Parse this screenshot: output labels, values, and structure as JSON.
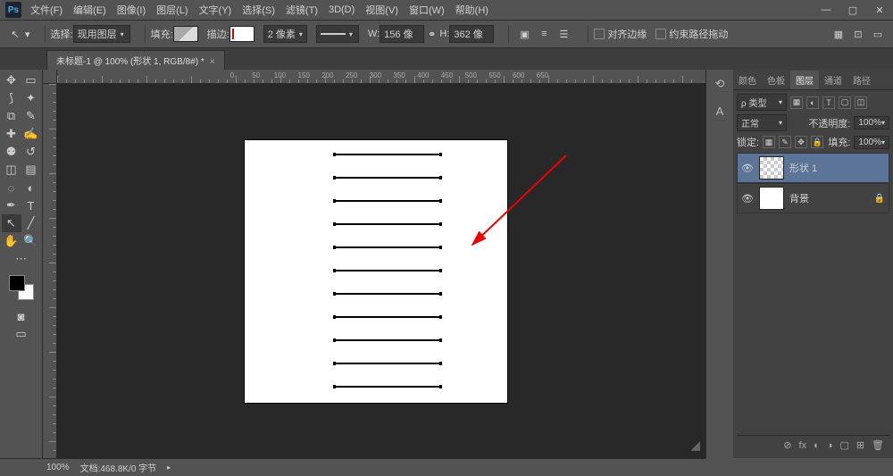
{
  "menu": {
    "items": [
      "文件(F)",
      "编辑(E)",
      "图像(I)",
      "图层(L)",
      "文字(Y)",
      "选择(S)",
      "滤镜(T)",
      "3D(D)",
      "视图(V)",
      "窗口(W)",
      "帮助(H)"
    ]
  },
  "logo": "Ps",
  "opt": {
    "select_label": "选择:",
    "select_value": "现用图层",
    "fill_label": "填充:",
    "stroke_label": "描边:",
    "stroke_width": "2 像素",
    "w_label": "W:",
    "w_value": "156 像",
    "link": "⚭",
    "h_label": "H:",
    "h_value": "362 像",
    "align_edges": "对齐边缘",
    "constrain": "约束路径拖动"
  },
  "tab": {
    "title": "未标题-1 @ 100% (形状 1, RGB/8#) *"
  },
  "ruler_labels": [
    "0",
    "50",
    "100",
    "150",
    "200",
    "250",
    "300",
    "350",
    "400",
    "450",
    "500",
    "550",
    "600",
    "650"
  ],
  "ruler_v": [
    "0",
    "5",
    "0",
    "0",
    "5",
    "0",
    "1",
    "0",
    "0",
    "1",
    "5",
    "0",
    "2",
    "0",
    "0",
    "2",
    "5",
    "0",
    "3",
    "0",
    "0"
  ],
  "panel_tabs": [
    "颜色",
    "色板",
    "图层",
    "通道",
    "路径"
  ],
  "layer_panel": {
    "kind": "ρ 类型",
    "blend": "正常",
    "opacity_label": "不透明度:",
    "opacity": "100%",
    "lock_label": "锁定:",
    "fill_label": "填充:",
    "fill": "100%",
    "layers": [
      {
        "name": "形状 1",
        "selected": true,
        "trans": true,
        "locked": false
      },
      {
        "name": "背景",
        "selected": false,
        "trans": false,
        "locked": true
      }
    ]
  },
  "foot_icons": [
    "⊘",
    "fx",
    "◐",
    "◑",
    "▢",
    "⊞",
    "🗑"
  ],
  "status": {
    "zoom": "100%",
    "doc": "文档:468.8K/0 字节"
  }
}
